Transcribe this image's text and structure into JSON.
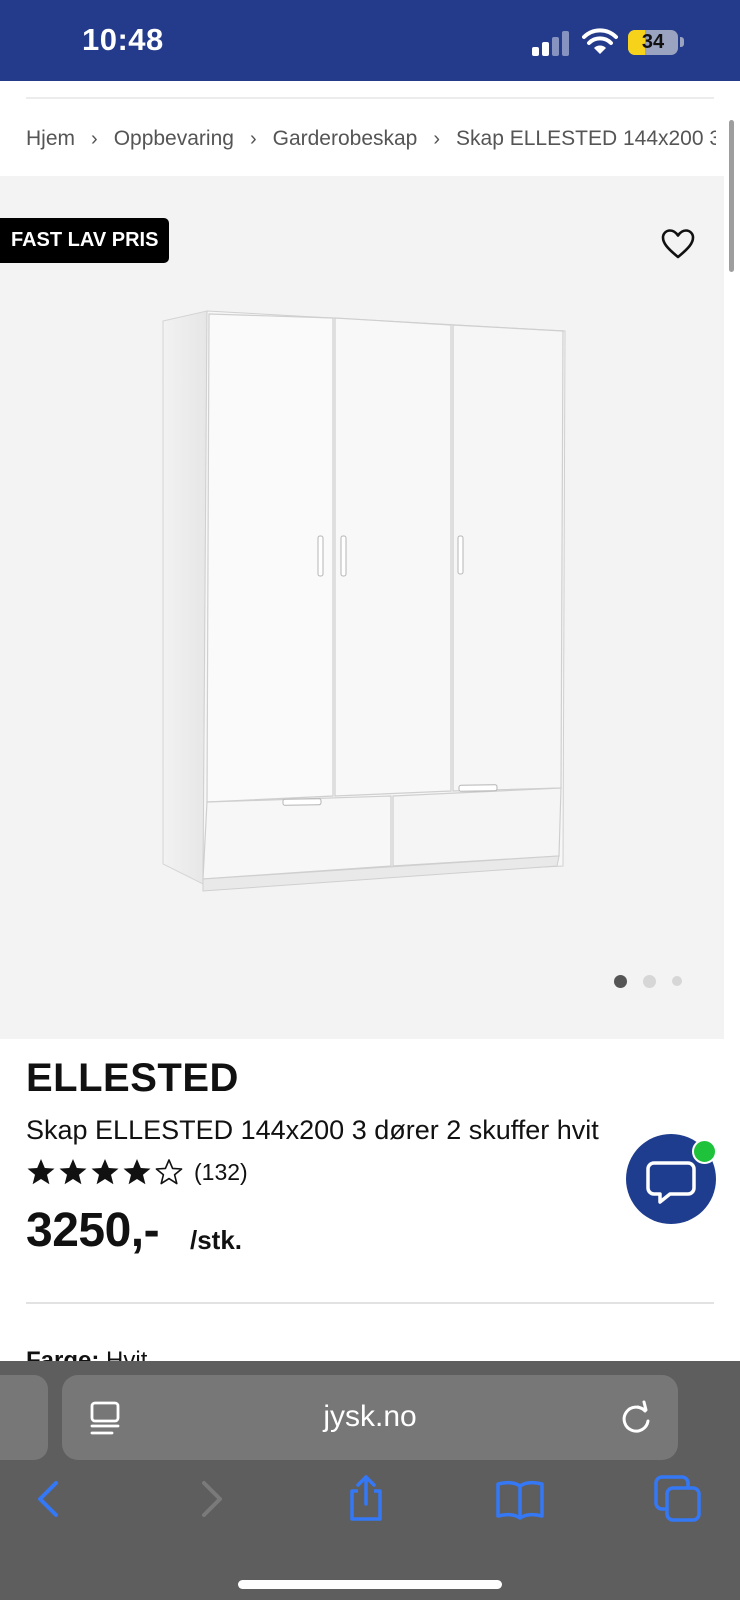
{
  "status_bar": {
    "time": "10:48",
    "battery": "34",
    "battery_level": 0.34,
    "bg_color": "#243a8a",
    "battery_color": "#f6d21a"
  },
  "breadcrumb": {
    "items": [
      "Hjem",
      "Oppbevaring",
      "Garderobeskap",
      "Skap ELLESTED 144x200 3"
    ],
    "separator": "›"
  },
  "gallery": {
    "badge": "FAST LAV PRIS",
    "image_count": 3,
    "active_image": 1,
    "favorite_icon": "heart-outline-icon"
  },
  "product": {
    "brand": "ELLESTED",
    "title": "Skap ELLESTED 144x200 3 dører 2 skuffer hvit",
    "rating": 4,
    "rating_max": 5,
    "review_count": "(132)",
    "price": "3250,-",
    "unit": "/stk.",
    "color_label": "Farge:",
    "color_value": "Hvit"
  },
  "chat": {
    "icon": "chat-bubble-icon",
    "status_color": "#1fc33b",
    "button_color": "#1f3d8f"
  },
  "browser": {
    "url": "jysk.no",
    "accent_color": "#3478f6",
    "toolbar": [
      "back-icon",
      "forward-icon",
      "share-icon",
      "bookmarks-icon",
      "tabs-icon"
    ]
  }
}
